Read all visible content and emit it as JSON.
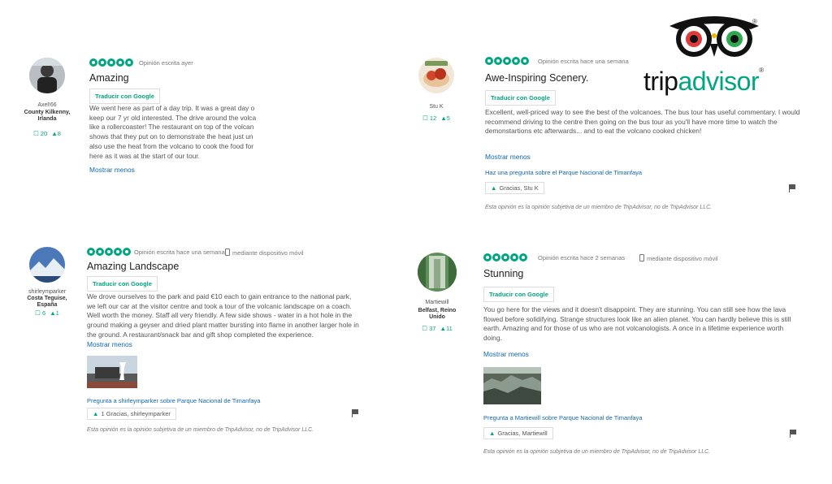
{
  "brand": {
    "wordmark_a": "trip",
    "wordmark_b": "advisor",
    "registered": "®",
    "owl_icon": "owl-logo-icon"
  },
  "reviews": [
    {
      "user": {
        "name": "Axel!66",
        "location": "County Kilkenny, Irlanda",
        "reviews": "20",
        "likes": "8"
      },
      "rating": 5,
      "meta": "Opinión escrita ayer",
      "device": "",
      "title": "Amazing",
      "translate": "Traducir con Google",
      "body": "We went here as part of a day trip. It was a great day o keep our 7 yr old interested. The drive around the volca like a rollercoaster! The restaurant on top of the volcan shows that they put on to demonstrate the heat just un also use the heat from the volcano to cook the food for here as it was at the start of our tour.",
      "more": "Mostrar menos"
    },
    {
      "user": {
        "name": "Stu K",
        "location": "",
        "reviews": "12",
        "likes": "5"
      },
      "rating": 5,
      "meta": "Opinión escrita hace una semana",
      "device": "",
      "title": "Awe-Inspiring Scenery.",
      "translate": "Traducir con Google",
      "body": "Excellent, well-priced way to see the best of the volcanoes. The bus tour has useful commentary. I would recommend driving to the centre then going on the bus tour as you'll have more time to watch the demonstartions etc afterwards... and to eat the volcano cooked chicken!",
      "more": "Mostrar menos",
      "ask": "Haz una pregunta sobre el Parque Nacional de Timanfaya",
      "thanks": "Gracias, Stu K",
      "disclaimer": "Esta opinión es la opinión subjetiva de un miembro de TripAdvisor, no de TripAdvisor LLC."
    },
    {
      "user": {
        "name": "shirleymparker",
        "location": "Costa Teguise, España",
        "reviews": "6",
        "likes": "1"
      },
      "rating": 5,
      "meta": "Opinión escrita hace una semana",
      "device": "mediante dispositivo móvil",
      "title": "Amazing Landscape",
      "translate": "Traducir con Google",
      "body": "We drove ourselves to the park and paid €10 each to gain entrance to the national park, we left our car at the visitor centre and took a tour of the volcanic landscape on a coach. Well worth the money. Staff all very friendly. A few side shows - water in a hot hole in the ground making a geyser and dried plant matter bursting into flame in another larger hole in the ground. A restaurant/snack bar and gift shop completed the experience.",
      "more": "Mostrar menos",
      "ask": "Pregunta a shirleymparker sobre Parque Nacional de Timanfaya",
      "thanks_count": "1",
      "thanks": "Gracias, shirleymparker",
      "disclaimer": "Esta opinión es la opinión subjetiva de un miembro de TripAdvisor, no de TripAdvisor LLC."
    },
    {
      "user": {
        "name": "Martiewill",
        "location": "Belfast, Reino Unido",
        "reviews": "37",
        "likes": "11"
      },
      "rating": 5,
      "meta": "Opinión escrita hace 2 semanas",
      "device": "mediante dispositivo móvil",
      "title": "Stunning",
      "translate": "Traducir con Google",
      "body": "You go here for the views and it doesn't disappoint. They are stunning. You can still see how the lava flowed before solidifying. Strange structures look like an alien planet. You can hardly believe this is still earth. Amazing and for those of us who are not volcanologists. A once in a lifetime experience worth doing.",
      "more": "Mostrar menos",
      "ask": "Pregunta a Martiewill sobre Parque Nacional de Timanfaya",
      "thanks": "Gracias, Martiewill",
      "disclaimer": "Esta opinión es la opinión subjetiva de un miembro de TripAdvisor, no de TripAdvisor LLC."
    }
  ],
  "colors": {
    "accent": "#00a680",
    "link": "#0f69b6",
    "owl_orange": "#f4b400",
    "owl_green": "#2fa84f",
    "owl_red": "#e03a3a"
  }
}
